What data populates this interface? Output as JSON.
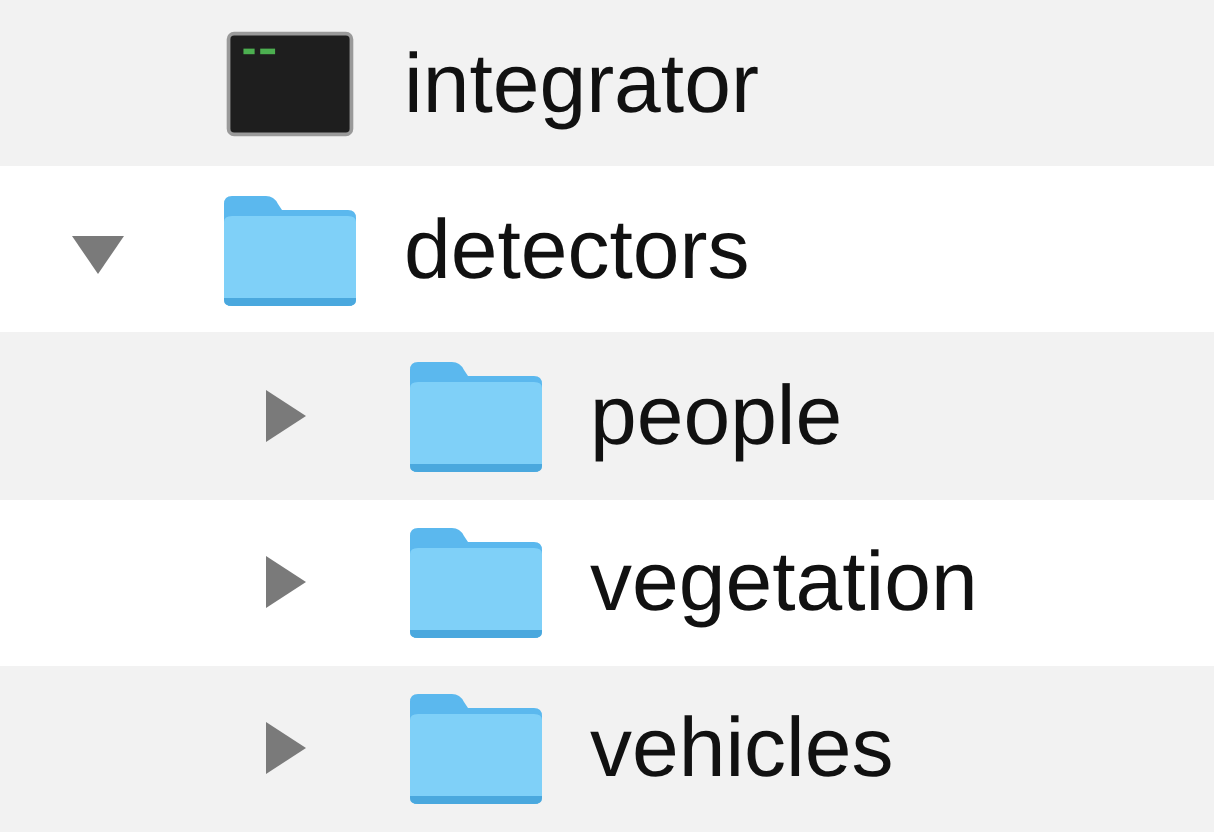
{
  "items": [
    {
      "name": "integrator",
      "kind": "executable"
    },
    {
      "name": "detectors",
      "kind": "folder",
      "expanded": true,
      "children": [
        {
          "name": "people",
          "kind": "folder",
          "expanded": false
        },
        {
          "name": "vegetation",
          "kind": "folder",
          "expanded": false
        },
        {
          "name": "vehicles",
          "kind": "folder",
          "expanded": false
        }
      ]
    }
  ]
}
